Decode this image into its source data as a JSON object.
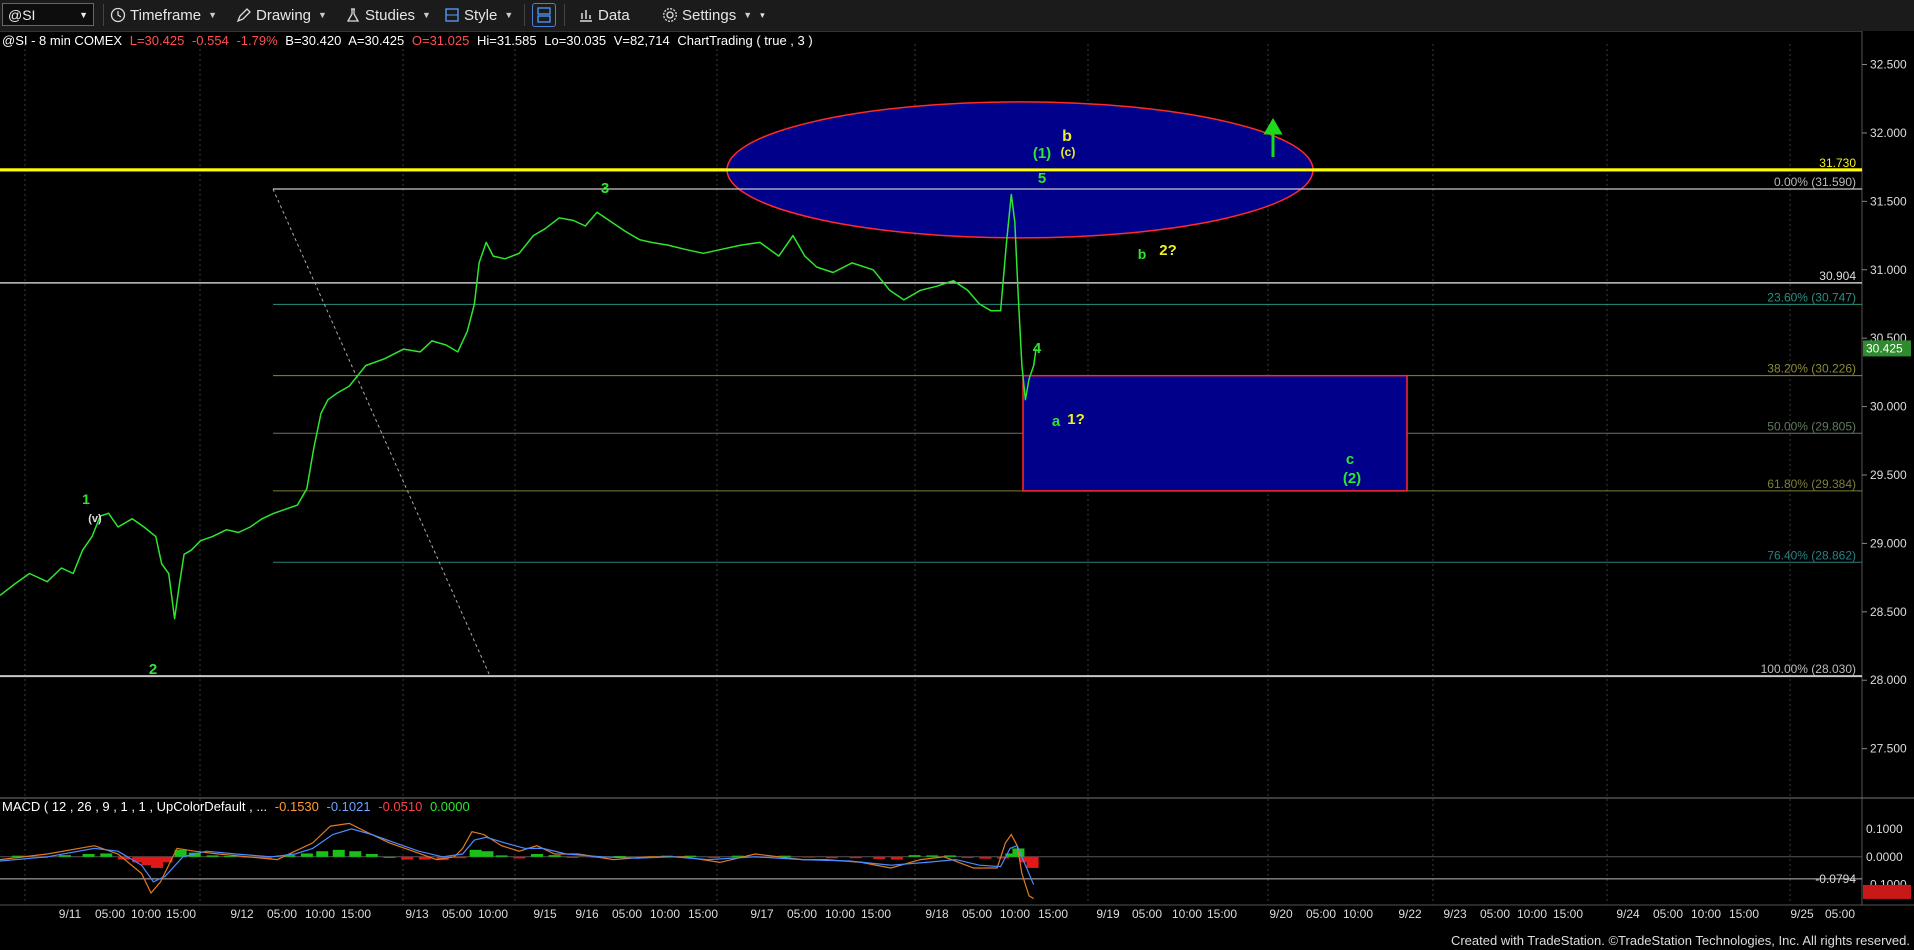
{
  "toolbar": {
    "symbol": "@SI",
    "items": [
      {
        "label": "Timeframe",
        "icon": "clock-icon"
      },
      {
        "label": "Drawing",
        "icon": "pencil-icon"
      },
      {
        "label": "Studies",
        "icon": "flask-icon"
      },
      {
        "label": "Style",
        "icon": "style-icon"
      },
      {
        "label": "Data",
        "icon": "bar-chart-icon"
      },
      {
        "label": "Settings",
        "icon": "gear-icon"
      }
    ]
  },
  "info_bar": {
    "symbol": "@SI - 8 min  COMEX",
    "last": "L=30.425",
    "change": "-0.554",
    "pct": "-1.79%",
    "bid": "B=30.420",
    "ask": "A=30.425",
    "open": "O=31.025",
    "high": "Hi=31.585",
    "low": "Lo=30.035",
    "volume": "V=82,714",
    "study": "ChartTrading ( true , 3 )"
  },
  "macd_legend": {
    "name": "MACD ( 12 , 26 , 9 , 1 , 1 , UpColorDefault , ...",
    "v1": "-0.1530",
    "v2": "-0.1021",
    "v3": "-0.0510",
    "v4": "0.0000"
  },
  "footer": "Created with TradeStation. ©TradeStation Technologies, Inc. All rights reserved.",
  "colors": {
    "price": "#2ee62e",
    "yellow_line": "#ffff00",
    "ellipse_fill": "#00008b",
    "ellipse_stroke": "#ff2a2a",
    "macd_line": "#e07a22",
    "signal_line": "#4a8cff",
    "hist_pos": "#18c018",
    "hist_neg": "#e01818"
  },
  "chart_data": {
    "type": "line",
    "x_tick_labels": [
      "9/11",
      "05:00",
      "10:00",
      "15:00",
      "9/12",
      "05:00",
      "10:00",
      "15:00",
      "9/13",
      "05:00",
      "10:00",
      "9/15",
      "9/16",
      "05:00",
      "10:00",
      "15:00",
      "9/17",
      "05:00",
      "10:00",
      "15:00",
      "9/18",
      "05:00",
      "10:00",
      "15:00",
      "9/19",
      "05:00",
      "10:00",
      "15:00",
      "9/20",
      "05:00",
      "10:00",
      "9/22",
      "9/23",
      "05:00",
      "10:00",
      "15:00",
      "9/24",
      "05:00",
      "10:00",
      "15:00",
      "9/25",
      "05:00"
    ],
    "y_ticks": [
      "32.500",
      "32.000",
      "31.500",
      "31.000",
      "30.500",
      "30.000",
      "29.500",
      "29.000",
      "28.500",
      "28.000",
      "27.500"
    ],
    "ylim": [
      27.3,
      32.65
    ],
    "last_price_label": "30.425",
    "price_series": [
      [
        0,
        28.62
      ],
      [
        12,
        28.7
      ],
      [
        25,
        28.78
      ],
      [
        40,
        28.72
      ],
      [
        52,
        28.82
      ],
      [
        62,
        28.78
      ],
      [
        70,
        28.95
      ],
      [
        78,
        29.05
      ],
      [
        85,
        29.2
      ],
      [
        92,
        29.22
      ],
      [
        100,
        29.12
      ],
      [
        112,
        29.18
      ],
      [
        122,
        29.12
      ],
      [
        132,
        29.05
      ],
      [
        137,
        28.85
      ],
      [
        143,
        28.78
      ],
      [
        148,
        28.45
      ],
      [
        152,
        28.7
      ],
      [
        156,
        28.92
      ],
      [
        162,
        28.95
      ],
      [
        170,
        29.02
      ],
      [
        180,
        29.05
      ],
      [
        192,
        29.1
      ],
      [
        202,
        29.08
      ],
      [
        212,
        29.12
      ],
      [
        222,
        29.18
      ],
      [
        232,
        29.22
      ],
      [
        242,
        29.25
      ],
      [
        252,
        29.28
      ],
      [
        260,
        29.4
      ],
      [
        266,
        29.7
      ],
      [
        272,
        29.95
      ],
      [
        278,
        30.05
      ],
      [
        286,
        30.1
      ],
      [
        296,
        30.15
      ],
      [
        310,
        30.3
      ],
      [
        326,
        30.35
      ],
      [
        342,
        30.42
      ],
      [
        356,
        30.4
      ],
      [
        366,
        30.48
      ],
      [
        378,
        30.45
      ],
      [
        388,
        30.4
      ],
      [
        396,
        30.55
      ],
      [
        402,
        30.75
      ],
      [
        406,
        31.05
      ],
      [
        412,
        31.2
      ],
      [
        418,
        31.1
      ],
      [
        428,
        31.08
      ],
      [
        440,
        31.12
      ],
      [
        452,
        31.25
      ],
      [
        462,
        31.3
      ],
      [
        474,
        31.38
      ],
      [
        486,
        31.36
      ],
      [
        496,
        31.32
      ],
      [
        506,
        31.42
      ],
      [
        518,
        31.35
      ],
      [
        530,
        31.28
      ],
      [
        542,
        31.22
      ],
      [
        552,
        31.2
      ],
      [
        566,
        31.18
      ],
      [
        580,
        31.15
      ],
      [
        596,
        31.12
      ],
      [
        612,
        31.15
      ],
      [
        628,
        31.18
      ],
      [
        644,
        31.2
      ],
      [
        660,
        31.1
      ],
      [
        672,
        31.25
      ],
      [
        682,
        31.1
      ],
      [
        692,
        31.02
      ],
      [
        706,
        30.98
      ],
      [
        722,
        31.05
      ],
      [
        740,
        31.0
      ],
      [
        754,
        30.85
      ],
      [
        766,
        30.78
      ],
      [
        780,
        30.85
      ],
      [
        794,
        30.88
      ],
      [
        808,
        30.92
      ],
      [
        820,
        30.85
      ],
      [
        830,
        30.75
      ],
      [
        840,
        30.7
      ],
      [
        848,
        30.7
      ],
      [
        853,
        31.2
      ],
      [
        857,
        31.55
      ],
      [
        860,
        31.35
      ],
      [
        863,
        30.8
      ],
      [
        866,
        30.3
      ],
      [
        869,
        30.05
      ],
      [
        872,
        30.2
      ],
      [
        876,
        30.3
      ],
      [
        878,
        30.42
      ]
    ],
    "horizontal_lines": [
      {
        "price": 31.73,
        "label": "31.730",
        "color": "#ffff00"
      },
      {
        "price": 30.904,
        "label": "30.904",
        "color": "#c8c8c8"
      }
    ],
    "fib_levels": [
      {
        "price": 31.59,
        "label": "0.00% (31.590)",
        "color": "#c8c8c8"
      },
      {
        "price": 30.747,
        "label": "23.60% (30.747)",
        "color": "#2a9080"
      },
      {
        "price": 30.226,
        "label": "38.20% (30.226)",
        "color": "#8a8a38"
      },
      {
        "price": 29.805,
        "label": "50.00% (29.805)",
        "color": "#5e7a5e"
      },
      {
        "price": 29.384,
        "label": "61.80% (29.384)",
        "color": "#7e7e38"
      },
      {
        "price": 28.862,
        "label": "76.40% (28.862)",
        "color": "#2a8080"
      },
      {
        "price": 28.03,
        "label": "100.00% (28.030)",
        "color": "#c8c8c8"
      }
    ],
    "boxes": [
      {
        "name": "target-zone-box",
        "top": 30.226,
        "bottom": 29.384
      }
    ],
    "wave_labels": [
      {
        "text": "1",
        "color": "#2ee62e"
      },
      {
        "text": "(v)",
        "color": "#e0e0e0"
      },
      {
        "text": "2",
        "color": "#2ee62e"
      },
      {
        "text": "3",
        "color": "#2ee62e"
      },
      {
        "text": "b",
        "color": "#f0f020"
      },
      {
        "text": "(1)",
        "color": "#2ee62e"
      },
      {
        "text": "(c)",
        "color": "#f0f020"
      },
      {
        "text": "5",
        "color": "#2ee62e"
      },
      {
        "text": "b",
        "color": "#2ee62e"
      },
      {
        "text": "2?",
        "color": "#f0f020"
      },
      {
        "text": "4",
        "color": "#2ee62e"
      },
      {
        "text": "a",
        "color": "#2ee62e"
      },
      {
        "text": "1?",
        "color": "#f0f020"
      },
      {
        "text": "c",
        "color": "#2ee62e"
      },
      {
        "text": "(2)",
        "color": "#2ee62e"
      }
    ],
    "macd": {
      "y_ticks": [
        "0.1000",
        "0.0000",
        "-0.1000"
      ],
      "ylim": [
        -0.155,
        0.15
      ],
      "current_label": "-0.0794",
      "current_value": -0.0794,
      "macd_line": [
        [
          0,
          -0.01
        ],
        [
          40,
          0.01
        ],
        [
          80,
          0.04
        ],
        [
          100,
          0.01
        ],
        [
          120,
          -0.06
        ],
        [
          128,
          -0.13
        ],
        [
          136,
          -0.09
        ],
        [
          150,
          0.03
        ],
        [
          165,
          0.02
        ],
        [
          185,
          0.01
        ],
        [
          210,
          0.0
        ],
        [
          235,
          -0.01
        ],
        [
          250,
          0.02
        ],
        [
          265,
          0.05
        ],
        [
          280,
          0.11
        ],
        [
          296,
          0.12
        ],
        [
          310,
          0.09
        ],
        [
          330,
          0.05
        ],
        [
          350,
          0.02
        ],
        [
          370,
          -0.01
        ],
        [
          385,
          0.0
        ],
        [
          392,
          0.03
        ],
        [
          400,
          0.09
        ],
        [
          410,
          0.08
        ],
        [
          425,
          0.04
        ],
        [
          440,
          0.02
        ],
        [
          455,
          0.04
        ],
        [
          470,
          0.01
        ],
        [
          490,
          0.01
        ],
        [
          520,
          -0.01
        ],
        [
          550,
          0.0
        ],
        [
          580,
          0.0
        ],
        [
          610,
          -0.02
        ],
        [
          640,
          0.01
        ],
        [
          660,
          0.0
        ],
        [
          680,
          -0.01
        ],
        [
          700,
          -0.01
        ],
        [
          730,
          -0.02
        ],
        [
          755,
          -0.04
        ],
        [
          780,
          -0.01
        ],
        [
          800,
          0.0
        ],
        [
          825,
          -0.04
        ],
        [
          845,
          -0.04
        ],
        [
          852,
          0.05
        ],
        [
          857,
          0.08
        ],
        [
          862,
          0.04
        ],
        [
          866,
          -0.06
        ],
        [
          872,
          -0.14
        ],
        [
          876,
          -0.15
        ]
      ],
      "signal_line": [
        [
          0,
          -0.015
        ],
        [
          40,
          0.0
        ],
        [
          80,
          0.03
        ],
        [
          100,
          0.02
        ],
        [
          120,
          -0.03
        ],
        [
          130,
          -0.09
        ],
        [
          140,
          -0.07
        ],
        [
          155,
          0.0
        ],
        [
          175,
          0.02
        ],
        [
          200,
          0.01
        ],
        [
          230,
          0.0
        ],
        [
          250,
          0.01
        ],
        [
          265,
          0.03
        ],
        [
          282,
          0.08
        ],
        [
          298,
          0.1
        ],
        [
          315,
          0.08
        ],
        [
          335,
          0.05
        ],
        [
          355,
          0.02
        ],
        [
          375,
          0.0
        ],
        [
          392,
          0.01
        ],
        [
          402,
          0.06
        ],
        [
          412,
          0.07
        ],
        [
          428,
          0.05
        ],
        [
          445,
          0.03
        ],
        [
          460,
          0.03
        ],
        [
          480,
          0.01
        ],
        [
          510,
          0.0
        ],
        [
          540,
          -0.005
        ],
        [
          570,
          0.0
        ],
        [
          600,
          -0.01
        ],
        [
          640,
          0.0
        ],
        [
          680,
          -0.01
        ],
        [
          720,
          -0.015
        ],
        [
          755,
          -0.03
        ],
        [
          785,
          -0.02
        ],
        [
          810,
          -0.01
        ],
        [
          830,
          -0.03
        ],
        [
          848,
          -0.035
        ],
        [
          856,
          0.03
        ],
        [
          862,
          0.04
        ],
        [
          868,
          -0.02
        ],
        [
          876,
          -0.1
        ]
      ],
      "histogram": [
        [
          10,
          0.004
        ],
        [
          30,
          -0.004
        ],
        [
          50,
          0.006
        ],
        [
          70,
          0.01
        ],
        [
          85,
          0.012
        ],
        [
          100,
          -0.01
        ],
        [
          112,
          -0.02
        ],
        [
          120,
          -0.03
        ],
        [
          128,
          -0.04
        ],
        [
          136,
          -0.02
        ],
        [
          148,
          0.025
        ],
        [
          160,
          0.015
        ],
        [
          175,
          0.005
        ],
        [
          190,
          0.003
        ],
        [
          205,
          -0.003
        ],
        [
          220,
          -0.006
        ],
        [
          240,
          0.006
        ],
        [
          255,
          0.012
        ],
        [
          268,
          0.02
        ],
        [
          282,
          0.025
        ],
        [
          296,
          0.02
        ],
        [
          310,
          0.01
        ],
        [
          325,
          0.0
        ],
        [
          340,
          -0.01
        ],
        [
          355,
          -0.01
        ],
        [
          370,
          -0.012
        ],
        [
          385,
          -0.005
        ],
        [
          398,
          0.025
        ],
        [
          408,
          0.02
        ],
        [
          420,
          0.005
        ],
        [
          435,
          -0.006
        ],
        [
          450,
          0.01
        ],
        [
          465,
          0.006
        ],
        [
          480,
          -0.004
        ],
        [
          500,
          -0.003
        ],
        [
          520,
          0.003
        ],
        [
          540,
          -0.003
        ],
        [
          560,
          0.004
        ],
        [
          580,
          0.004
        ],
        [
          600,
          -0.004
        ],
        [
          620,
          0.004
        ],
        [
          640,
          -0.003
        ],
        [
          660,
          0.004
        ],
        [
          680,
          -0.003
        ],
        [
          700,
          -0.005
        ],
        [
          720,
          -0.005
        ],
        [
          740,
          -0.008
        ],
        [
          755,
          -0.01
        ],
        [
          770,
          0.006
        ],
        [
          785,
          0.005
        ],
        [
          800,
          0.005
        ],
        [
          815,
          -0.004
        ],
        [
          830,
          -0.007
        ],
        [
          845,
          -0.006
        ],
        [
          852,
          0.012
        ],
        [
          858,
          0.03
        ],
        [
          864,
          -0.02
        ],
        [
          870,
          -0.04
        ]
      ]
    }
  }
}
